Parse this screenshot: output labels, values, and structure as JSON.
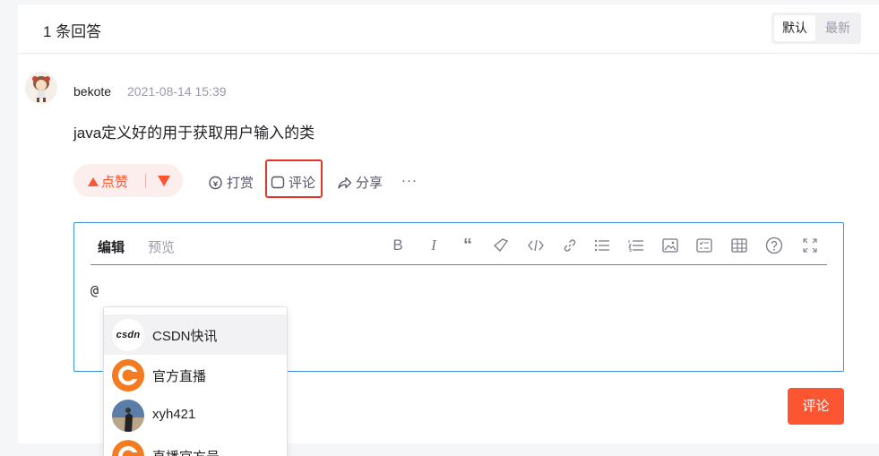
{
  "header": {
    "title": "1 条回答"
  },
  "sort": {
    "default_label": "默认",
    "newest_label": "最新"
  },
  "answer": {
    "username": "bekote",
    "time": "2021-08-14 15:39",
    "text": "java定义好的用于获取用户输入的类"
  },
  "actions": {
    "like_label": "点赞",
    "tip_label": "打赏",
    "comment_label": "评论",
    "share_label": "分享",
    "more_label": "···"
  },
  "editor": {
    "tab_edit": "编辑",
    "tab_preview": "预览",
    "content": "@",
    "tools": [
      "bold-icon",
      "italic-icon",
      "quote-icon",
      "highlight-icon",
      "code-icon",
      "link-icon",
      "unordered-list-icon",
      "ordered-list-icon",
      "image-icon",
      "checklist-icon",
      "table-icon",
      "help-icon",
      "fullscreen-icon"
    ]
  },
  "mentions": [
    {
      "name": "CSDN快讯",
      "logo_text": "CSDN"
    },
    {
      "name": "官方直播",
      "logo_text": "C"
    },
    {
      "name": "xyh421"
    },
    {
      "name": "直播官方号",
      "logo_text": "C"
    }
  ],
  "submit": {
    "label": "评论"
  },
  "colors": {
    "accent": "#fc5531",
    "editor_border": "#3d8ee0",
    "highlight_box": "#e33622"
  }
}
